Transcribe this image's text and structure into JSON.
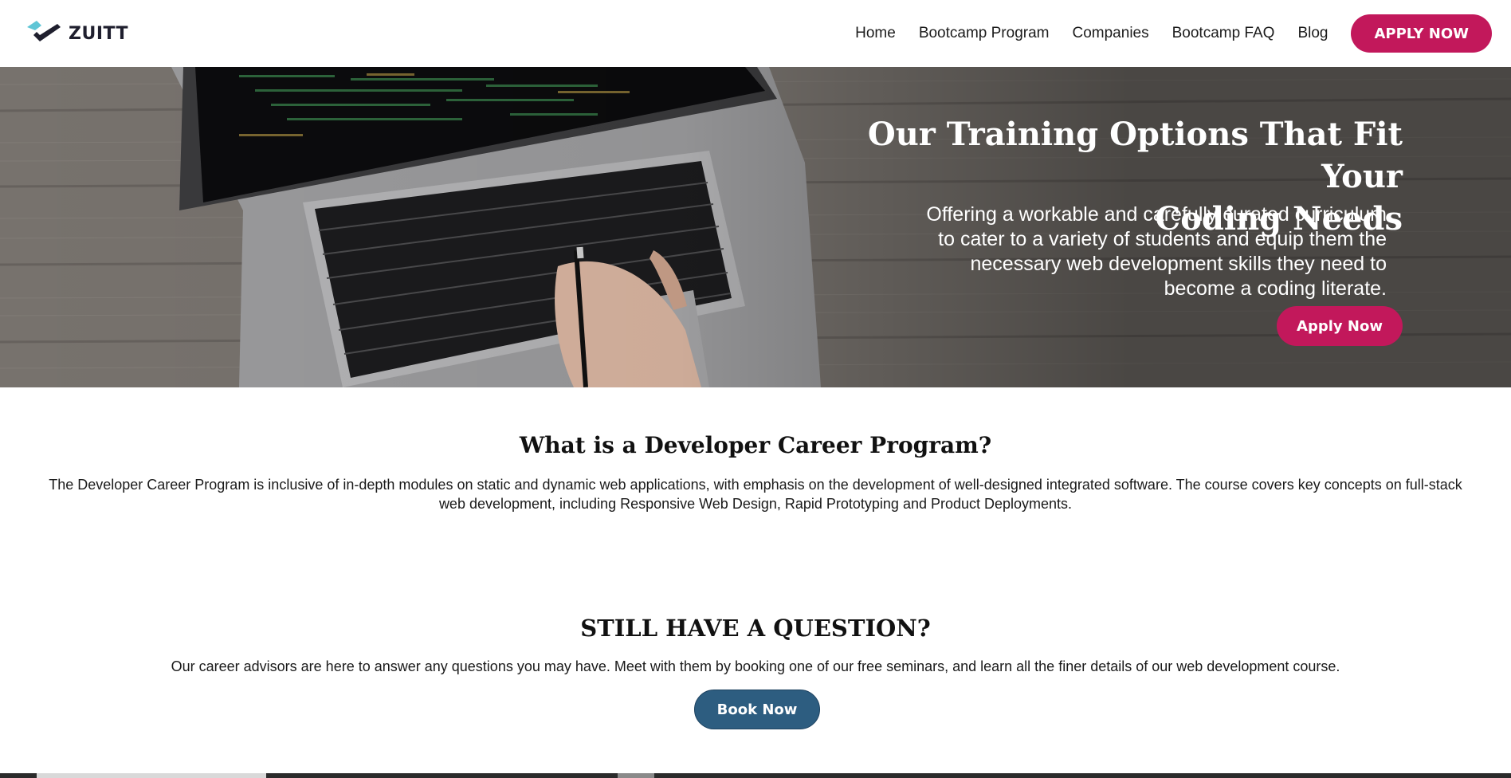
{
  "brand": {
    "name": "ZUITT",
    "colors": {
      "accent": "#c2185b",
      "secondary": "#2d5d80",
      "logo_teal": "#5fc6d6",
      "logo_dark": "#1f1f2e"
    }
  },
  "nav": {
    "items": [
      {
        "label": "Home"
      },
      {
        "label": "Bootcamp Program"
      },
      {
        "label": "Companies"
      },
      {
        "label": "Bootcamp FAQ"
      },
      {
        "label": "Blog"
      }
    ],
    "cta_label": "APPLY NOW"
  },
  "hero": {
    "title_line1": "Our Training Options That Fit Your",
    "title_line2": "Coding Needs",
    "subtitle": "Offering a workable and carefully curated curriculum to cater to a variety of students and equip them the necessary web development skills they need to become a coding literate.",
    "button_label": "Apply Now"
  },
  "program": {
    "title": "What is a Developer Career Program?",
    "text": "The Developer Career Program is inclusive of in-depth modules on static and dynamic web applications, with emphasis on the development of well-designed integrated software. The course covers key concepts on full-stack web development, including Responsive Web Design, Rapid Prototyping and Product Deployments."
  },
  "question": {
    "title": "STILL HAVE A QUESTION?",
    "text": "Our career advisors are here to answer any questions you may have. Meet with them by booking one of our free seminars, and learn all the finer details of our web development course.",
    "button_label": "Book Now"
  }
}
